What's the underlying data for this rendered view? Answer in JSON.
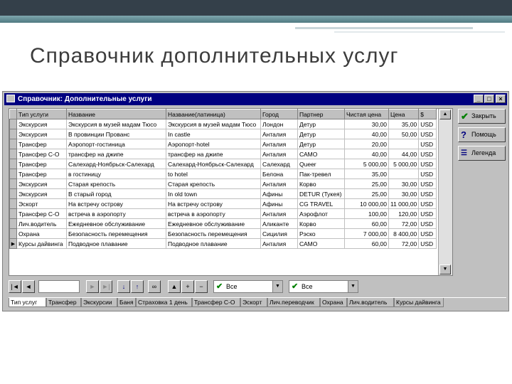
{
  "slide": {
    "title": "Справочник дополнительных услуг"
  },
  "window": {
    "title": "Справочник: Дополнительные услуги"
  },
  "table": {
    "columns": [
      "Тип услуги",
      "Название",
      "Название(латиница)",
      "Город",
      "Партнер",
      "Чистая цена",
      "Цена",
      "$"
    ],
    "rows": [
      [
        "Экскурсия",
        "Экскурсия в музей мадам Тюсо",
        "Экскурсия в музей мадам Тюсо",
        "Лондон",
        "Детур",
        "30,00",
        "35,00",
        "USD"
      ],
      [
        "Экскурсия",
        "В провинции Прованс",
        "In castle",
        "Анталия",
        "Детур",
        "40,00",
        "50,00",
        "USD"
      ],
      [
        "Трансфер",
        "Аэропорт-гостиница",
        "Аэропорт-hotel",
        "Анталия",
        "Детур",
        "20,00",
        "",
        "USD"
      ],
      [
        "Трансфер С-О",
        "трансфер на джипе",
        "трансфер на джипе",
        "Анталия",
        "САМО",
        "40,00",
        "44,00",
        "USD"
      ],
      [
        "Трансфер",
        "Салехард-Ноябрьск-Салехард",
        "Салехард-Ноябрьск-Салехард",
        "Салехард",
        "Queer",
        "5 000,00",
        "5 000,00",
        "USD"
      ],
      [
        "Трансфер",
        "в гостиницу",
        "to hotel",
        "Белона",
        "Пак-тревел",
        "35,00",
        "",
        "USD"
      ],
      [
        "Экскурсия",
        "Старая крепость",
        "Старая крепость",
        "Анталия",
        "Корво",
        "25,00",
        "30,00",
        "USD"
      ],
      [
        "Экскурсия",
        "В старый город",
        "In old town",
        "Афины",
        "DETUR (Тукея)",
        "25,00",
        "30,00",
        "USD"
      ],
      [
        "Эскорт",
        "На встречу острову",
        "На встречу острову",
        "Афины",
        "CG TRAVEL",
        "10 000,00",
        "11 000,00",
        "USD"
      ],
      [
        "Трансфер С-О",
        "встреча в аэропорту",
        "встреча в аэропорту",
        "Анталия",
        "Аэрофлот",
        "100,00",
        "120,00",
        "USD"
      ],
      [
        "Лич.водитель",
        "Ежедневное обслуживание",
        "Ежедневное обслуживание",
        "Аликанте",
        "Корво",
        "60,00",
        "72,00",
        "USD"
      ],
      [
        "Охрана",
        "Безопасность перемещения",
        "Безопасность перемещения",
        "Сицилия",
        "Рэско",
        "7 000,00",
        "8 400,00",
        "USD"
      ],
      [
        "Курсы дайвинга",
        "Подводное плавание",
        "Подводное плавание",
        "Анталия",
        "САМО",
        "60,00",
        "72,00",
        "USD"
      ]
    ]
  },
  "side_buttons": {
    "close": "Закрыть",
    "help": "Помощь",
    "legend": "Легенда"
  },
  "filters": {
    "filter1": "Все",
    "filter2": "Все"
  },
  "tabs": [
    "Тип услуг",
    "Трансфер",
    "Экскурсии",
    "Баня",
    "Страховка 1 день",
    "Трансфер С-О",
    "Эскорт",
    "Лич.переводчик",
    "Охрана",
    "Лич.водитель",
    "Курсы дайвинга"
  ],
  "colors": {
    "titlebar": "#000080",
    "window": "#c0c0c0",
    "accent_check": "#008000"
  }
}
